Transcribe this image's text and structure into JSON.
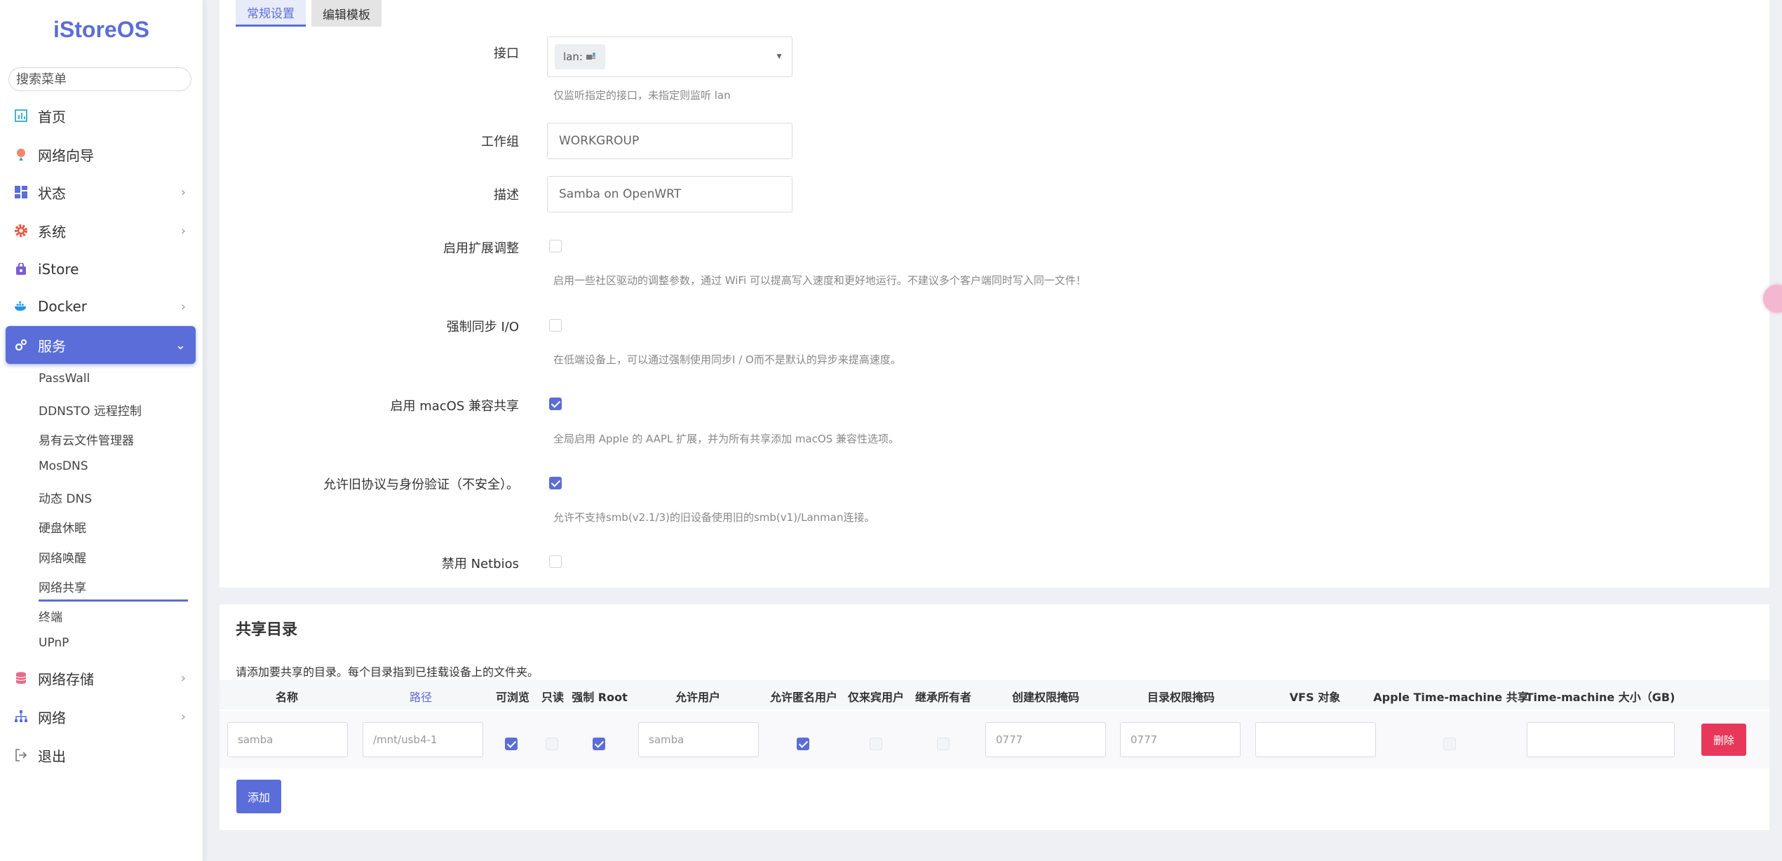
{
  "sidebar": {
    "logo": "iStoreOS",
    "search_placeholder": "搜索菜单",
    "items": [
      {
        "label": "首页"
      },
      {
        "label": "网络向导"
      },
      {
        "label": "状态"
      },
      {
        "label": "系统"
      },
      {
        "label": "iStore"
      },
      {
        "label": "Docker"
      },
      {
        "label": "服务"
      },
      {
        "label": "网络存储"
      },
      {
        "label": "网络"
      },
      {
        "label": "退出"
      }
    ],
    "sub_items": [
      {
        "label": "PassWall"
      },
      {
        "label": "DDNSTO 远程控制"
      },
      {
        "label": "易有云文件管理器"
      },
      {
        "label": "MosDNS"
      },
      {
        "label": "动态 DNS"
      },
      {
        "label": "硬盘休眠"
      },
      {
        "label": "网络唤醒"
      },
      {
        "label": "网络共享"
      },
      {
        "label": "终端"
      },
      {
        "label": "UPnP"
      }
    ]
  },
  "tabs": [
    {
      "label": "常规设置"
    },
    {
      "label": "编辑模板"
    }
  ],
  "form": {
    "interface": {
      "label": "接口",
      "value": "lan:",
      "help": "仅监听指定的接口，未指定则监听 lan"
    },
    "workgroup": {
      "label": "工作组",
      "value": "WORKGROUP"
    },
    "description": {
      "label": "描述",
      "value": "Samba on OpenWRT"
    },
    "extended_tuning": {
      "label": "启用扩展调整",
      "checked": false,
      "help": "启用一些社区驱动的调整参数，通过 WiFi 可以提高写入速度和更好地运行。不建议多个客户端同时写入同一文件！"
    },
    "force_sync_io": {
      "label": "强制同步 I/O",
      "checked": false,
      "help": "在低端设备上，可以通过强制使用同步I / O而不是默认的异步来提高速度。"
    },
    "macos_compat": {
      "label": "启用 macOS 兼容共享",
      "checked": true,
      "help": "全局启用 Apple 的 AAPL 扩展，并为所有共享添加 macOS 兼容性选项。"
    },
    "legacy_auth": {
      "label": "允许旧协议与身份验证（不安全）。",
      "checked": true,
      "help": "允许不支持smb(v2.1/3)的旧设备使用旧的smb(v1)/Lanman连接。"
    },
    "disable_netbios": {
      "label": "禁用 Netbios",
      "checked": false
    }
  },
  "shares": {
    "title": "共享目录",
    "description": "请添加要共享的目录。每个目录指到已挂载设备上的文件夹。",
    "columns": [
      "名称",
      "路径",
      "可浏览",
      "只读",
      "强制 Root",
      "允许用户",
      "允许匿名用户",
      "仅来宾用户",
      "继承所有者",
      "创建权限掩码",
      "目录权限掩码",
      "VFS 对象",
      "Apple Time-machine 共享",
      "Time-machine 大小（GB)"
    ],
    "row": {
      "name_placeholder": "samba",
      "path_placeholder": "/mnt/usb4-1",
      "browsable": true,
      "read_only": false,
      "force_root": true,
      "users_placeholder": "samba",
      "guest_ok": true,
      "guest_only": false,
      "inherit_owner": false,
      "create_mask_placeholder": "0777",
      "dir_mask_placeholder": "0777",
      "vfs_value": "",
      "timemachine": false,
      "tm_size_value": ""
    },
    "delete_label": "删除",
    "add_label": "添加"
  }
}
